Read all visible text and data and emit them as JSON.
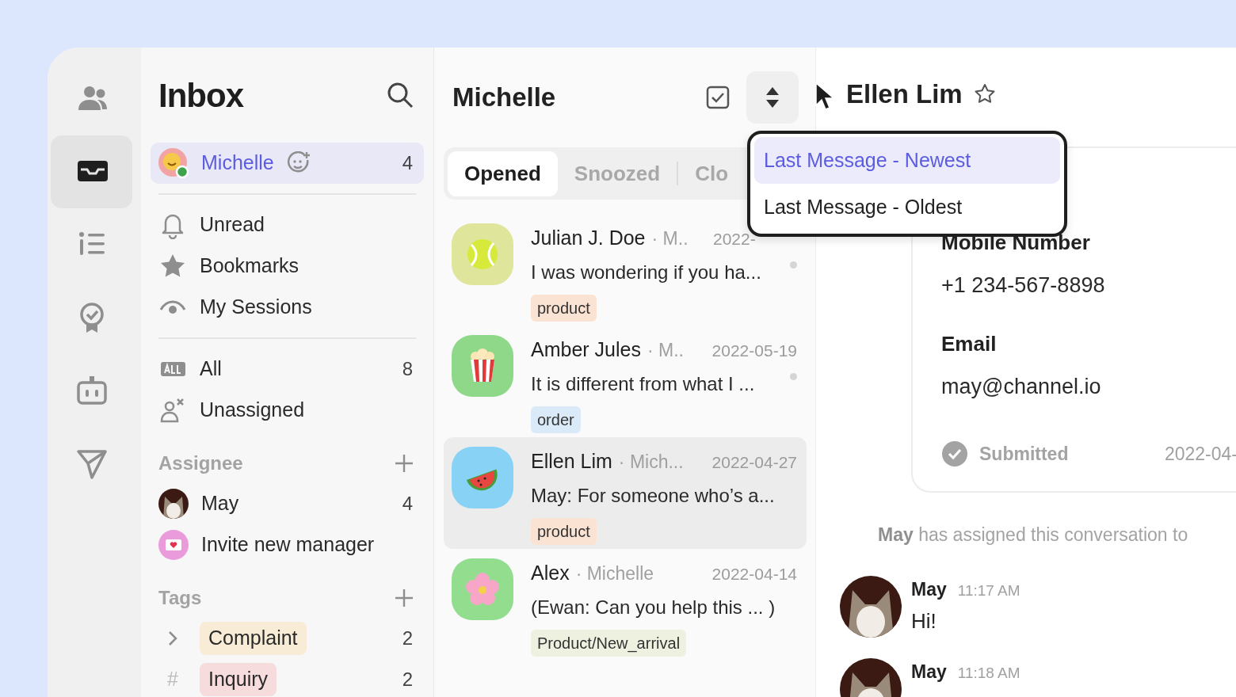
{
  "rail": [
    {
      "kind": "people",
      "selected": false
    },
    {
      "kind": "inbox",
      "selected": true
    },
    {
      "kind": "list",
      "selected": false
    },
    {
      "kind": "badge",
      "selected": false
    },
    {
      "kind": "bot",
      "selected": false
    },
    {
      "kind": "send",
      "selected": false
    }
  ],
  "sidebar": {
    "title": "Inbox",
    "me": {
      "name": "Michelle",
      "count": "4",
      "selected": true,
      "online": true
    },
    "filters": [
      {
        "kind": "bell",
        "label": "Unread"
      },
      {
        "kind": "star",
        "label": "Bookmarks"
      },
      {
        "kind": "eye",
        "label": "My Sessions"
      }
    ],
    "views": [
      {
        "kind": "all",
        "label": "All",
        "count": "8"
      },
      {
        "kind": "unassigned",
        "label": "Unassigned"
      }
    ],
    "assignee": {
      "title": "Assignee",
      "items": [
        {
          "kind": "person",
          "name": "May",
          "count": "4"
        },
        {
          "kind": "invite",
          "name": "Invite new manager"
        }
      ]
    },
    "tags": {
      "title": "Tags",
      "items": [
        {
          "kind": "group",
          "label": "Complaint",
          "count": "2",
          "color": "#f8ecd6"
        },
        {
          "kind": "tag",
          "marker": "#",
          "label": "Inquiry",
          "count": "2",
          "color": "#f6dcdc"
        }
      ]
    }
  },
  "list": {
    "title": "Michelle",
    "tabs": [
      {
        "label": "Opened",
        "selected": true
      },
      {
        "label": "Snoozed",
        "selected": false
      },
      {
        "label": "Clo",
        "selected": false
      }
    ],
    "sort_menu": {
      "open": true,
      "items": [
        {
          "label": "Last Message - Newest",
          "selected": true
        },
        {
          "label": "Last Message - Oldest",
          "selected": false
        }
      ]
    },
    "conversations": [
      {
        "kind": "tennis",
        "name": "Julian J. Doe",
        "manager": "· M..",
        "date": "2022-",
        "preview": "I was wondering if you ha...",
        "tag": "product",
        "color": "#fbe3d3",
        "unread": true,
        "selected": false
      },
      {
        "kind": "popcorn",
        "name": "Amber Jules",
        "manager": "· M..",
        "date": "2022-05-19",
        "preview": "It is different from what I ...",
        "tag": "order",
        "color": "#dbeaf8",
        "unread": true,
        "selected": false
      },
      {
        "kind": "watermelon",
        "name": "Ellen Lim",
        "manager": "· Mich...",
        "date": "2022-04-27",
        "preview": "May: For someone who’s a...",
        "tag": "product",
        "color": "#fbe3d3",
        "unread": false,
        "selected": true
      },
      {
        "kind": "flower",
        "name": "Alex",
        "manager": "· Michelle",
        "date": "2022-04-14",
        "preview": "(Ewan: Can you help this ... )",
        "tag": "Product/New_arrival",
        "color": "#eef0e0",
        "unread": false,
        "selected": false
      }
    ]
  },
  "chat": {
    "contact": {
      "name": "Ellen Lim",
      "starred": false
    },
    "profile": {
      "fields": [
        {
          "label": "Mobile Number",
          "value": "+1 234-567-8898"
        },
        {
          "label": "Email",
          "value": "may@channel.io"
        }
      ],
      "status": {
        "label": "Submitted",
        "date": "2022-04-"
      }
    },
    "system_message": "**May** has assigned this conversation to",
    "messages": [
      {
        "author": "May",
        "time": "11:17 AM",
        "text": "Hi!"
      },
      {
        "author": "May",
        "time": "11:18 AM"
      }
    ]
  }
}
